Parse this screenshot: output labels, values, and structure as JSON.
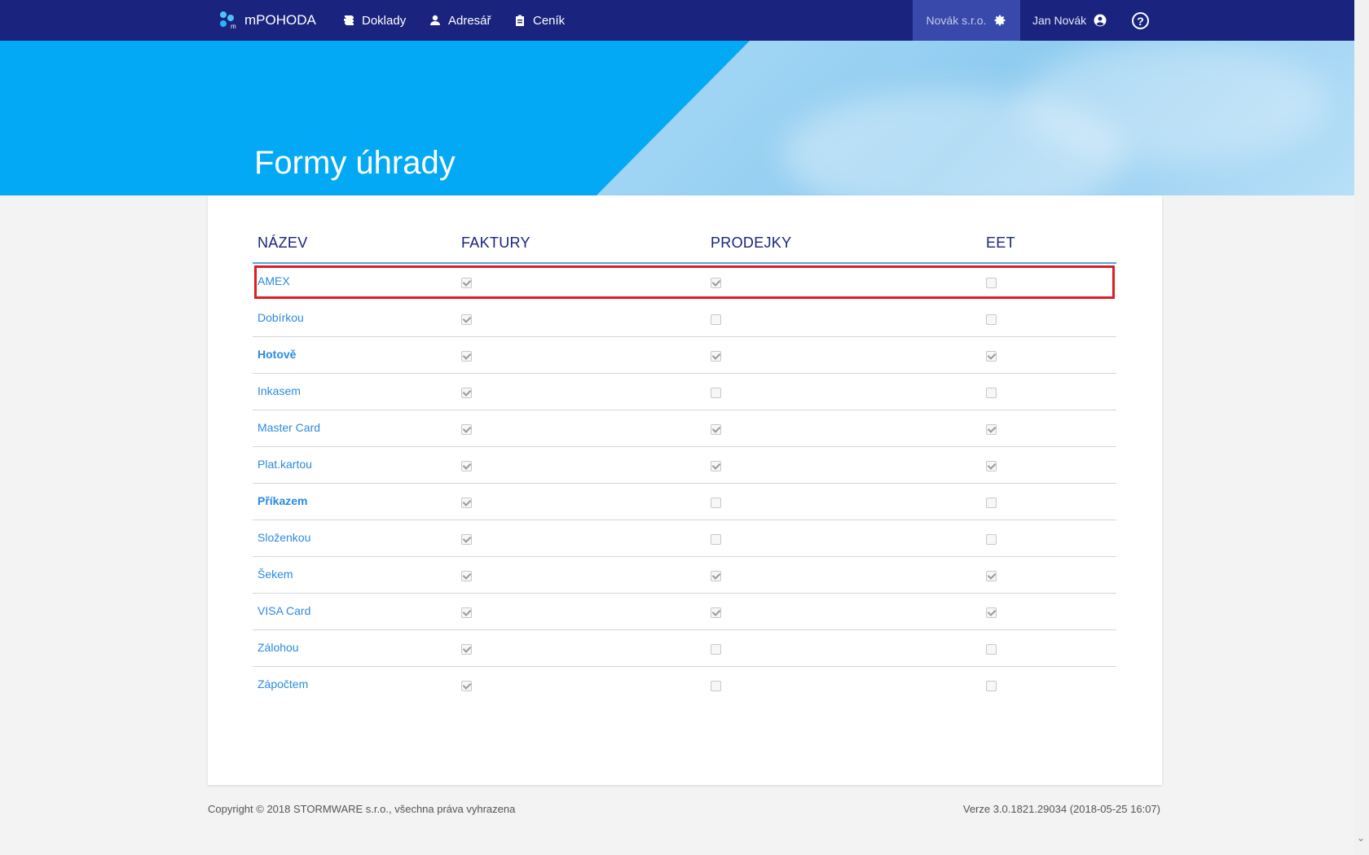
{
  "nav": {
    "brand": "mPOHODA",
    "items": [
      {
        "label": "Doklady",
        "icon": "documents-icon"
      },
      {
        "label": "Adresář",
        "icon": "person-icon"
      },
      {
        "label": "Ceník",
        "icon": "clipboard-icon"
      }
    ],
    "company": "Novák s.r.o.",
    "user": "Jan Novák",
    "help": "?"
  },
  "page": {
    "title": "Formy úhrady"
  },
  "table": {
    "headers": [
      "NÁZEV",
      "FAKTURY",
      "PRODEJKY",
      "EET"
    ],
    "rows": [
      {
        "name": "AMEX",
        "bold": false,
        "faktury": true,
        "prodejky": true,
        "eet": false,
        "highlighted": true
      },
      {
        "name": "Dobírkou",
        "bold": false,
        "faktury": true,
        "prodejky": false,
        "eet": false
      },
      {
        "name": "Hotově",
        "bold": true,
        "faktury": true,
        "prodejky": true,
        "eet": true
      },
      {
        "name": "Inkasem",
        "bold": false,
        "faktury": true,
        "prodejky": false,
        "eet": false
      },
      {
        "name": "Master Card",
        "bold": false,
        "faktury": true,
        "prodejky": true,
        "eet": true
      },
      {
        "name": "Plat.kartou",
        "bold": false,
        "faktury": true,
        "prodejky": true,
        "eet": true
      },
      {
        "name": "Příkazem",
        "bold": true,
        "faktury": true,
        "prodejky": false,
        "eet": false
      },
      {
        "name": "Složenkou",
        "bold": false,
        "faktury": true,
        "prodejky": false,
        "eet": false
      },
      {
        "name": "Šekem",
        "bold": false,
        "faktury": true,
        "prodejky": true,
        "eet": true
      },
      {
        "name": "VISA Card",
        "bold": false,
        "faktury": true,
        "prodejky": true,
        "eet": true
      },
      {
        "name": "Zálohou",
        "bold": false,
        "faktury": true,
        "prodejky": false,
        "eet": false
      },
      {
        "name": "Zápočtem",
        "bold": false,
        "faktury": true,
        "prodejky": false,
        "eet": false
      }
    ]
  },
  "footer": {
    "copyright": "Copyright © 2018 STORMWARE s.r.o., všechna práva vyhrazena",
    "version": "Verze 3.0.1821.29034 (2018-05-25 16:07)"
  },
  "colors": {
    "navbar": "#1a237e",
    "company_bg": "#3949ab",
    "hero_blue": "#03a9f4",
    "link": "#2a8ae0",
    "highlight": "#e11b22"
  }
}
